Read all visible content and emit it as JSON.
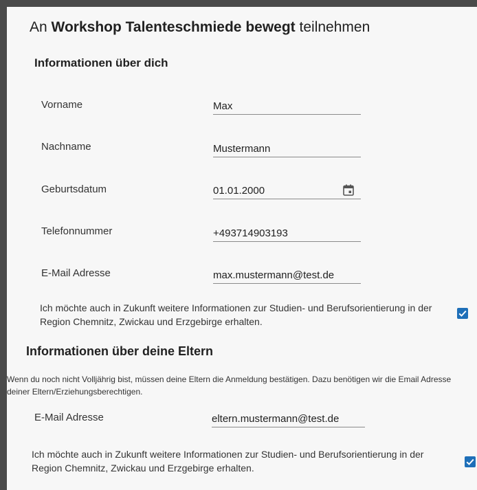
{
  "header": {
    "prefix": "An",
    "workshop_name": "Workshop Talenteschmiede bewegt",
    "suffix": "teilnehmen"
  },
  "personal": {
    "heading": "Informationen über dich",
    "fields": [
      {
        "label": "Vorname",
        "value": "Max"
      },
      {
        "label": "Nachname",
        "value": "Mustermann"
      },
      {
        "label": "Geburtsdatum",
        "value": "01.01.2000"
      },
      {
        "label": "Telefonnummer",
        "value": "+493714903193"
      },
      {
        "label": "E-Mail Adresse",
        "value": "max.mustermann@test.de"
      }
    ],
    "optin_text": "Ich möchte auch in Zukunft weitere Informationen zur Studien- und Berufsorientierung in der Region Chemnitz, Zwickau und Erzgebirge erhalten.",
    "optin_checked": true
  },
  "parents": {
    "heading": "Informationen über deine Eltern",
    "hint": "Wenn du noch nicht Volljährig bist, müssen deine Eltern die Anmeldung bestätigen. Dazu benötigen wir die Email Adresse deiner Eltern/Erziehungsberechtigen.",
    "email_label": "E-Mail Adresse",
    "email_value": "eltern.mustermann@test.de",
    "optin_text": "Ich möchte auch in Zukunft weitere Informationen zur Studien- und Berufsorientierung in der Region Chemnitz, Zwickau und Erzgebirge erhalten.",
    "optin_checked": true
  },
  "colors": {
    "checkbox": "#1e6fb8",
    "frame": "#4a4a4a"
  },
  "icons": {
    "date_picker": "calendar-icon",
    "checkmark": "checkmark-icon"
  }
}
